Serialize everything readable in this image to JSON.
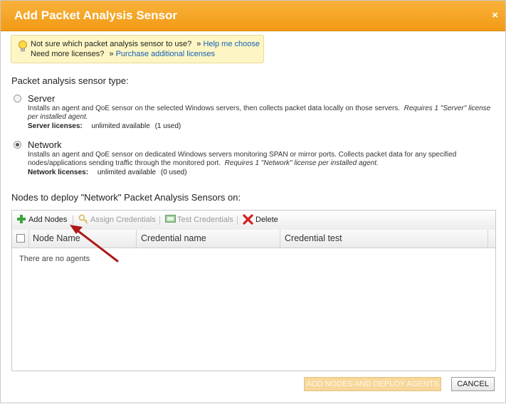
{
  "dialog": {
    "title": "Add Packet Analysis Sensor",
    "close_glyph": "×"
  },
  "hint": {
    "question": "Not sure which packet analysis sensor to use?",
    "help_link": "Help me choose",
    "licenses_question": "Need more licenses?",
    "purchase_link": "Purchase additional licenses"
  },
  "sensor_type": {
    "heading": "Packet analysis sensor type:",
    "options": [
      {
        "label": "Server",
        "selected": false,
        "description": "Installs an agent and QoE sensor on the selected Windows servers, then collects packet data locally on those servers.",
        "requirement": "Requires 1 \"Server\" license per installed agent.",
        "license_label": "Server licenses:",
        "license_available": "unlimited available",
        "license_used": "(1 used)"
      },
      {
        "label": "Network",
        "selected": true,
        "description": "Installs an agent and QoE sensor on dedicated Windows servers monitoring SPAN or mirror ports.  Collects packet data for any specified nodes/applications sending traffic through the monitored port.",
        "requirement": "Requires 1 \"Network\" license per installed agent.",
        "license_label": "Network licenses:",
        "license_available": "unlimited available",
        "license_used": "(0 used)"
      }
    ]
  },
  "nodes": {
    "heading": "Nodes to deploy \"Network\" Packet Analysis Sensors on:",
    "toolbar": {
      "add_nodes": "Add Nodes",
      "assign_credentials": "Assign Credentials",
      "test_credentials": "Test Credentials",
      "delete": "Delete"
    },
    "columns": [
      "Node Name",
      "Credential name",
      "Credential test"
    ],
    "empty_message": "There are no agents"
  },
  "footer": {
    "deploy_button": "ADD NODES AND DEPLOY AGENTS",
    "cancel_button": "CANCEL"
  },
  "colors": {
    "title_bar": "#f29a14",
    "hint_background": "#fdf6c4",
    "link": "#1560b8",
    "annotation_arrow": "#b01818"
  }
}
